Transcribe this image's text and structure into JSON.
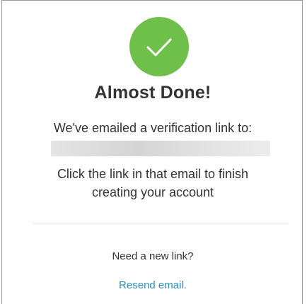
{
  "status": {
    "icon": "checkmark-icon",
    "icon_color": "#6ec04a",
    "title": "Almost Done!"
  },
  "message": {
    "emailed_text": "We've emailed a verification link to:",
    "email_value": "",
    "instruction_line1": "Click the link in that email to finish",
    "instruction_line2": "creating your account"
  },
  "resend": {
    "prompt": "Need a new link?",
    "link_label": "Resend email.",
    "link_color": "#2a8ec4"
  }
}
